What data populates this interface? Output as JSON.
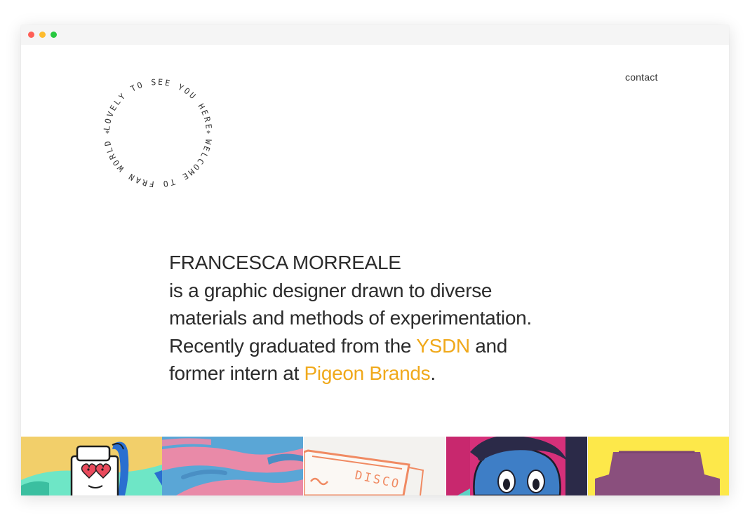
{
  "window": {
    "controls": [
      "close",
      "minimize",
      "maximize"
    ]
  },
  "badge": {
    "top_text": "LOVELY TO SEE YOU HERE",
    "bottom_text": "WELCOME TO FRAN WORLD",
    "separator": "*"
  },
  "nav": {
    "contact_label": "contact"
  },
  "intro": {
    "name": "FRANCESCA MORREALE",
    "line1": "is a graphic designer drawn to diverse",
    "line2": "materials and methods of experimentation.",
    "line3_pre": "Recently graduated from the ",
    "ysdn": "YSDN",
    "line3_post": " and",
    "line4_pre": "former intern at ",
    "pigeon": "Pigeon Brands",
    "line4_post": "."
  },
  "gallery": {
    "tiles": [
      {
        "label": "heart-eyes-character",
        "bg": "#f2cf6a"
      },
      {
        "label": "pink-blue-brushstrokes",
        "bg": "#5aa6d6"
      },
      {
        "label": "disco-sketch",
        "bg": "#f3f2ef",
        "text": "DISCO"
      },
      {
        "label": "blue-face-character",
        "bg": "#d6307a"
      },
      {
        "label": "purple-hat",
        "bg": "#fde84a"
      }
    ]
  },
  "colors": {
    "accent": "#f0a91b",
    "text": "#2b2b2b"
  }
}
